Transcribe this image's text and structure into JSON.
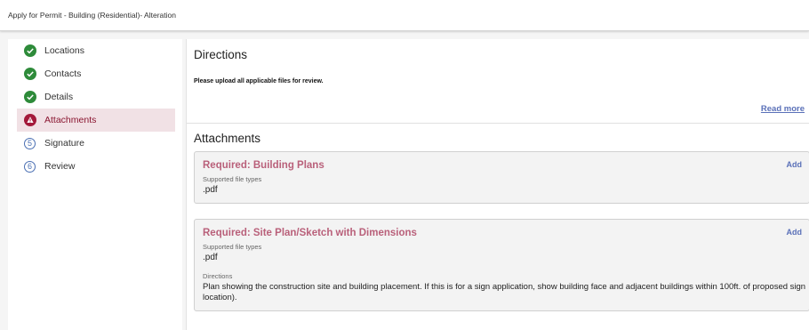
{
  "header": {
    "title": "Apply for Permit - Building (Residential)- Alteration"
  },
  "steps": [
    {
      "label": "Locations",
      "icon": "check-circle-icon",
      "state": "complete"
    },
    {
      "label": "Contacts",
      "icon": "check-circle-icon",
      "state": "complete"
    },
    {
      "label": "Details",
      "icon": "check-circle-icon",
      "state": "complete"
    },
    {
      "label": "Attachments",
      "icon": "warning-circle-icon",
      "state": "active"
    },
    {
      "label": "Signature",
      "number": "5",
      "state": "pending"
    },
    {
      "label": "Review",
      "number": "6",
      "state": "pending"
    }
  ],
  "directions": {
    "title": "Directions",
    "text": "Please upload all applicable files for review.",
    "read_more": "Read more"
  },
  "attachments": {
    "title": "Attachments",
    "items": [
      {
        "title": "Required: Building Plans",
        "add_label": "Add",
        "types_label": "Supported file types",
        "types": ".pdf"
      },
      {
        "title": "Required: Site Plan/Sketch with Dimensions",
        "add_label": "Add",
        "types_label": "Supported file types",
        "types": ".pdf",
        "directions_label": "Directions",
        "directions": "Plan showing the construction site and building placement. If this is for a sign application, show building face and adjacent buildings within 100ft. of proposed sign location)."
      }
    ]
  },
  "colors": {
    "complete": "#2e8b3a",
    "active_icon": "#a3193a",
    "active_bg": "#f1e1e5",
    "required_title": "#b9607a",
    "link": "#5a70b8"
  }
}
